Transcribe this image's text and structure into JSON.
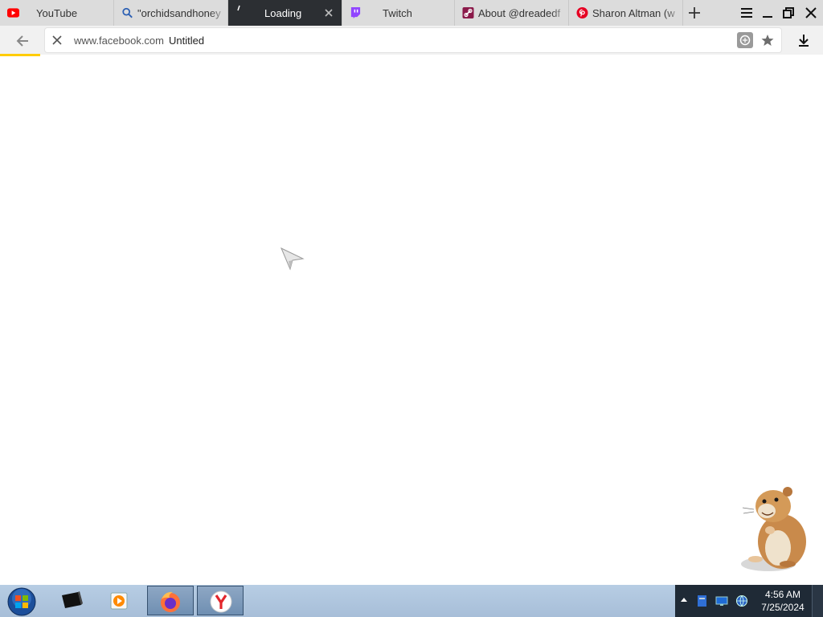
{
  "tabs": [
    {
      "label": "YouTube",
      "icon": "youtube-icon"
    },
    {
      "label": "\"orchidsandhoney",
      "icon": "search-icon"
    },
    {
      "label": "Loading",
      "icon": "loading-spinner-icon",
      "active": true
    },
    {
      "label": "Twitch",
      "icon": "twitch-icon"
    },
    {
      "label": "About @dreadedf",
      "icon": "link-icon"
    },
    {
      "label": "Sharon Altman (w",
      "icon": "pinterest-icon"
    }
  ],
  "address_bar": {
    "host": "www.facebook.com",
    "title": "Untitled"
  },
  "taskbar": {
    "time": "4:56 AM",
    "date": "7/25/2024"
  },
  "colors": {
    "tab_strip": "#dcdcdc",
    "active_tab": "#2c2f33",
    "progress": "#ffcc00",
    "taskbar": "#b0c6df"
  }
}
